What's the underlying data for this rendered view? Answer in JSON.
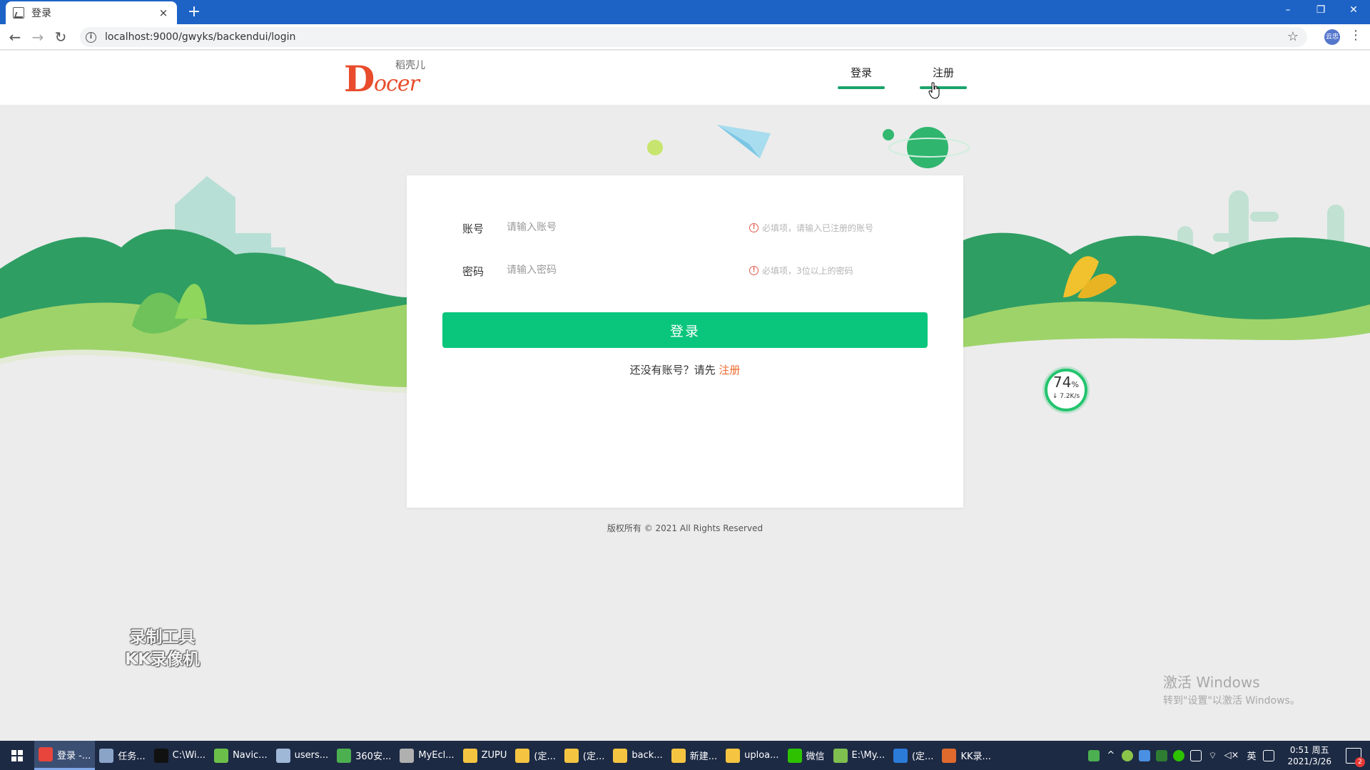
{
  "browser": {
    "tab_title": "登录",
    "tab_close": "×",
    "new_tab": "+",
    "url": "localhost:9000/gwyks/backendui/login",
    "profile_label": "云忠",
    "window_controls": [
      "–",
      "❐",
      "✕"
    ]
  },
  "header": {
    "logo_brand_letter": "D",
    "logo_brand_rest": "ocer",
    "logo_chinese": "稻壳儿",
    "nav": [
      {
        "label": "登录",
        "active": true
      },
      {
        "label": "注册",
        "active": false
      }
    ]
  },
  "login_form": {
    "account_label": "账号",
    "account_placeholder": "请输入账号",
    "account_hint": "必填项，请输入已注册的账号",
    "password_label": "密码",
    "password_placeholder": "请输入密码",
    "password_hint": "必填项，3位以上的密码",
    "submit_label": "登录",
    "register_prompt": "还没有账号？请先 ",
    "register_link": "注册"
  },
  "footer": {
    "copyright": "版权所有 © 2021 All Rights Reserved"
  },
  "overlays": {
    "speed_percent": "74",
    "speed_percent_unit": "%",
    "speed_rate": "↓ 7.2K/s",
    "watermark_line1": "录制工具",
    "watermark_line2": "KK录像机",
    "activate_title": "激活 Windows",
    "activate_sub": "转到\"设置\"以激活 Windows。"
  },
  "taskbar": {
    "items": [
      {
        "label": "登录 -...",
        "icon": "chrome-icon",
        "color": "#e8453c",
        "active": true
      },
      {
        "label": "任务...",
        "icon": "task-manager-icon",
        "color": "#8aa4c8",
        "active": false
      },
      {
        "label": "C:\\Wi...",
        "icon": "cmd-icon",
        "color": "#111111",
        "active": false
      },
      {
        "label": "Navic...",
        "icon": "navicat-icon",
        "color": "#6cc04a",
        "active": false
      },
      {
        "label": "users...",
        "icon": "table-icon",
        "color": "#9fb8d8",
        "active": false
      },
      {
        "label": "360安...",
        "icon": "shield-360-icon",
        "color": "#4caf50",
        "active": false
      },
      {
        "label": "MyEcl...",
        "icon": "myeclipse-icon",
        "color": "#b0b0b0",
        "active": false
      },
      {
        "label": "ZUPU",
        "icon": "folder-icon",
        "color": "#f5c542",
        "active": false
      },
      {
        "label": "(定...",
        "icon": "folder-icon",
        "color": "#f5c542",
        "active": false
      },
      {
        "label": "(定...",
        "icon": "folder-icon",
        "color": "#f5c542",
        "active": false
      },
      {
        "label": "back...",
        "icon": "folder-icon",
        "color": "#f5c542",
        "active": false
      },
      {
        "label": "新建...",
        "icon": "folder-icon",
        "color": "#f5c542",
        "active": false
      },
      {
        "label": "uploa...",
        "icon": "folder-icon",
        "color": "#f5c542",
        "active": false
      },
      {
        "label": "微信",
        "icon": "wechat-icon",
        "color": "#2dc100",
        "active": false
      },
      {
        "label": "E:\\My...",
        "icon": "notepad-icon",
        "color": "#7fbf4f",
        "active": false
      },
      {
        "label": "(定...",
        "icon": "vscode-icon",
        "color": "#2b7bd9",
        "active": false
      },
      {
        "label": "KK录...",
        "icon": "kk-recorder-icon",
        "color": "#e06a2d",
        "active": false
      }
    ],
    "tray": {
      "lang": "英",
      "time": "0:51 周五",
      "date": "2021/3/26",
      "notification_count": "2"
    }
  },
  "colors": {
    "accent_green": "#0ac57c",
    "nav_underline": "#1aa36b",
    "link_orange": "#f06a2d",
    "warn_red": "#e05a4e",
    "titlebar_blue": "#1d63c6"
  }
}
